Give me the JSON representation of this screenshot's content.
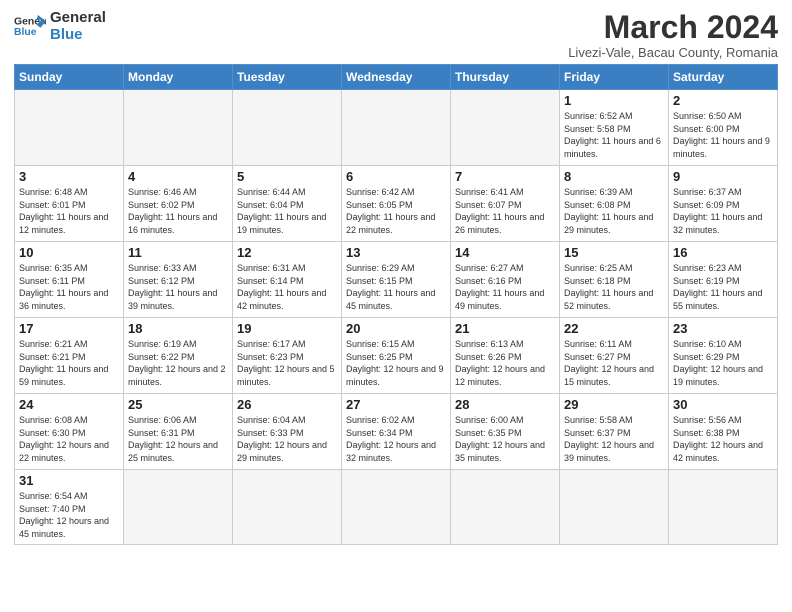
{
  "header": {
    "logo_general": "General",
    "logo_blue": "Blue",
    "month_title": "March 2024",
    "subtitle": "Livezi-Vale, Bacau County, Romania"
  },
  "weekdays": [
    "Sunday",
    "Monday",
    "Tuesday",
    "Wednesday",
    "Thursday",
    "Friday",
    "Saturday"
  ],
  "weeks": [
    [
      {
        "day": "",
        "info": ""
      },
      {
        "day": "",
        "info": ""
      },
      {
        "day": "",
        "info": ""
      },
      {
        "day": "",
        "info": ""
      },
      {
        "day": "",
        "info": ""
      },
      {
        "day": "1",
        "info": "Sunrise: 6:52 AM\nSunset: 5:58 PM\nDaylight: 11 hours and 6 minutes."
      },
      {
        "day": "2",
        "info": "Sunrise: 6:50 AM\nSunset: 6:00 PM\nDaylight: 11 hours and 9 minutes."
      }
    ],
    [
      {
        "day": "3",
        "info": "Sunrise: 6:48 AM\nSunset: 6:01 PM\nDaylight: 11 hours and 12 minutes."
      },
      {
        "day": "4",
        "info": "Sunrise: 6:46 AM\nSunset: 6:02 PM\nDaylight: 11 hours and 16 minutes."
      },
      {
        "day": "5",
        "info": "Sunrise: 6:44 AM\nSunset: 6:04 PM\nDaylight: 11 hours and 19 minutes."
      },
      {
        "day": "6",
        "info": "Sunrise: 6:42 AM\nSunset: 6:05 PM\nDaylight: 11 hours and 22 minutes."
      },
      {
        "day": "7",
        "info": "Sunrise: 6:41 AM\nSunset: 6:07 PM\nDaylight: 11 hours and 26 minutes."
      },
      {
        "day": "8",
        "info": "Sunrise: 6:39 AM\nSunset: 6:08 PM\nDaylight: 11 hours and 29 minutes."
      },
      {
        "day": "9",
        "info": "Sunrise: 6:37 AM\nSunset: 6:09 PM\nDaylight: 11 hours and 32 minutes."
      }
    ],
    [
      {
        "day": "10",
        "info": "Sunrise: 6:35 AM\nSunset: 6:11 PM\nDaylight: 11 hours and 36 minutes."
      },
      {
        "day": "11",
        "info": "Sunrise: 6:33 AM\nSunset: 6:12 PM\nDaylight: 11 hours and 39 minutes."
      },
      {
        "day": "12",
        "info": "Sunrise: 6:31 AM\nSunset: 6:14 PM\nDaylight: 11 hours and 42 minutes."
      },
      {
        "day": "13",
        "info": "Sunrise: 6:29 AM\nSunset: 6:15 PM\nDaylight: 11 hours and 45 minutes."
      },
      {
        "day": "14",
        "info": "Sunrise: 6:27 AM\nSunset: 6:16 PM\nDaylight: 11 hours and 49 minutes."
      },
      {
        "day": "15",
        "info": "Sunrise: 6:25 AM\nSunset: 6:18 PM\nDaylight: 11 hours and 52 minutes."
      },
      {
        "day": "16",
        "info": "Sunrise: 6:23 AM\nSunset: 6:19 PM\nDaylight: 11 hours and 55 minutes."
      }
    ],
    [
      {
        "day": "17",
        "info": "Sunrise: 6:21 AM\nSunset: 6:21 PM\nDaylight: 11 hours and 59 minutes."
      },
      {
        "day": "18",
        "info": "Sunrise: 6:19 AM\nSunset: 6:22 PM\nDaylight: 12 hours and 2 minutes."
      },
      {
        "day": "19",
        "info": "Sunrise: 6:17 AM\nSunset: 6:23 PM\nDaylight: 12 hours and 5 minutes."
      },
      {
        "day": "20",
        "info": "Sunrise: 6:15 AM\nSunset: 6:25 PM\nDaylight: 12 hours and 9 minutes."
      },
      {
        "day": "21",
        "info": "Sunrise: 6:13 AM\nSunset: 6:26 PM\nDaylight: 12 hours and 12 minutes."
      },
      {
        "day": "22",
        "info": "Sunrise: 6:11 AM\nSunset: 6:27 PM\nDaylight: 12 hours and 15 minutes."
      },
      {
        "day": "23",
        "info": "Sunrise: 6:10 AM\nSunset: 6:29 PM\nDaylight: 12 hours and 19 minutes."
      }
    ],
    [
      {
        "day": "24",
        "info": "Sunrise: 6:08 AM\nSunset: 6:30 PM\nDaylight: 12 hours and 22 minutes."
      },
      {
        "day": "25",
        "info": "Sunrise: 6:06 AM\nSunset: 6:31 PM\nDaylight: 12 hours and 25 minutes."
      },
      {
        "day": "26",
        "info": "Sunrise: 6:04 AM\nSunset: 6:33 PM\nDaylight: 12 hours and 29 minutes."
      },
      {
        "day": "27",
        "info": "Sunrise: 6:02 AM\nSunset: 6:34 PM\nDaylight: 12 hours and 32 minutes."
      },
      {
        "day": "28",
        "info": "Sunrise: 6:00 AM\nSunset: 6:35 PM\nDaylight: 12 hours and 35 minutes."
      },
      {
        "day": "29",
        "info": "Sunrise: 5:58 AM\nSunset: 6:37 PM\nDaylight: 12 hours and 39 minutes."
      },
      {
        "day": "30",
        "info": "Sunrise: 5:56 AM\nSunset: 6:38 PM\nDaylight: 12 hours and 42 minutes."
      }
    ],
    [
      {
        "day": "31",
        "info": "Sunrise: 6:54 AM\nSunset: 7:40 PM\nDaylight: 12 hours and 45 minutes."
      },
      {
        "day": "",
        "info": ""
      },
      {
        "day": "",
        "info": ""
      },
      {
        "day": "",
        "info": ""
      },
      {
        "day": "",
        "info": ""
      },
      {
        "day": "",
        "info": ""
      },
      {
        "day": "",
        "info": ""
      }
    ]
  ]
}
